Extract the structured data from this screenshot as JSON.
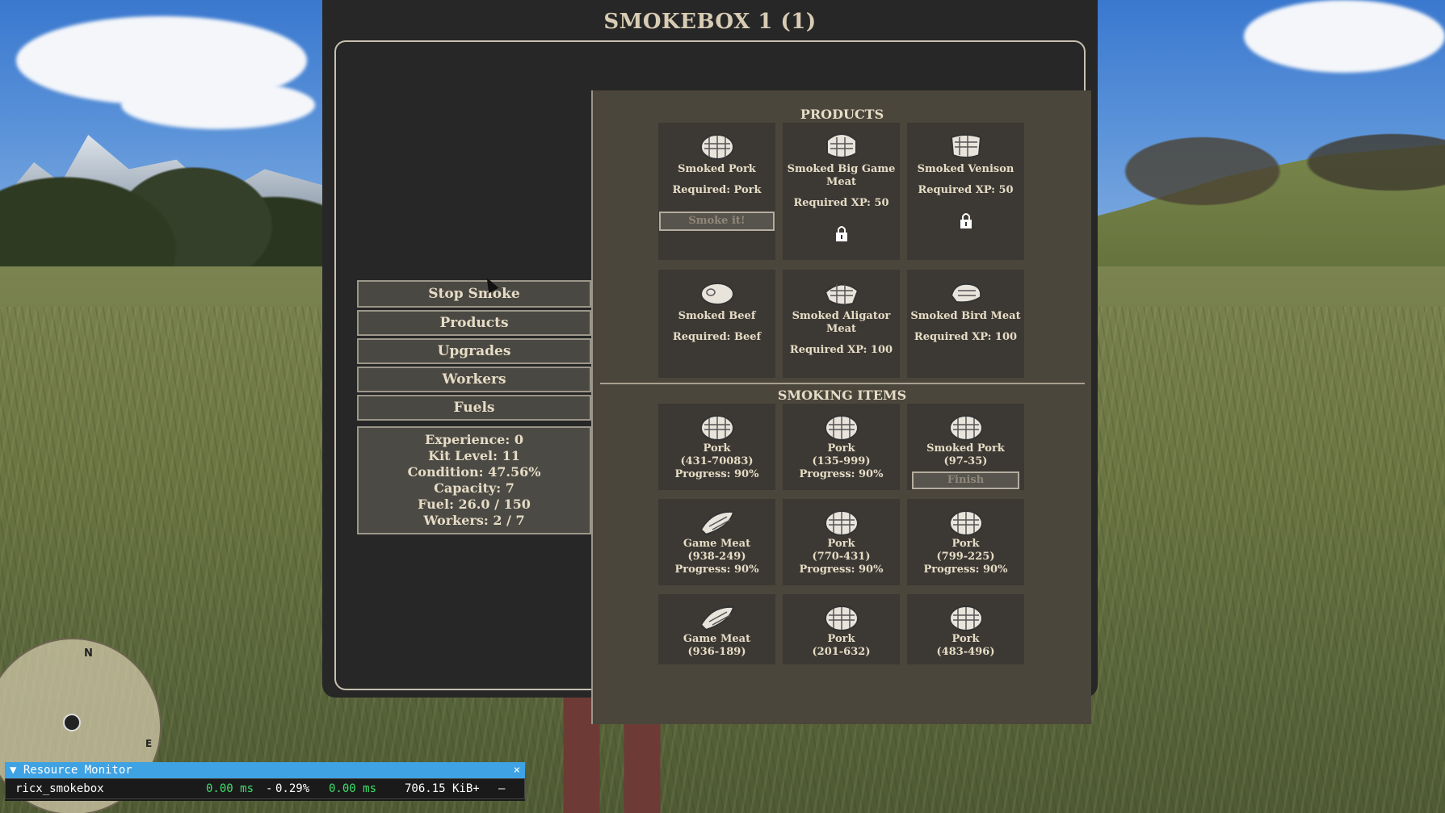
{
  "panel": {
    "title": "SMOKEBOX 1 (1)"
  },
  "sidebar": {
    "buttons": [
      "Stop Smoke",
      "Products",
      "Upgrades",
      "Workers",
      "Fuels"
    ],
    "stats": [
      "Experience: 0",
      "Kit Level: 11",
      "Condition: 47.56%",
      "Capacity: 7",
      "Fuel: 26.0 / 150",
      "Workers: 2 / 7"
    ]
  },
  "products": {
    "title": "PRODUCTS",
    "smoke_label": "Smoke it!",
    "items": [
      {
        "name": "Smoked Pork",
        "required": "Required: Pork",
        "locked": false,
        "icon": "pork-icon"
      },
      {
        "name": "Smoked Big Game Meat",
        "required": "Required XP: 50",
        "locked": true,
        "icon": "big-game-meat-icon"
      },
      {
        "name": "Smoked Venison",
        "required": "Required XP: 50",
        "locked": true,
        "icon": "venison-icon"
      },
      {
        "name": "Smoked Beef",
        "required": "Required: Beef",
        "locked": false,
        "icon": "beef-icon"
      },
      {
        "name": "Smoked Aligator Meat",
        "required": "Required XP: 100",
        "locked": false,
        "icon": "aligator-meat-icon"
      },
      {
        "name": "Smoked Bird Meat",
        "required": "Required XP: 100",
        "locked": false,
        "icon": "bird-meat-icon"
      }
    ]
  },
  "smoking_items": {
    "title": "SMOKING ITEMS",
    "finish_label": "Finish",
    "items": [
      {
        "name": "Pork",
        "code": "(431-70083)",
        "progress": "Progress: 90%",
        "icon": "pork-icon"
      },
      {
        "name": "Pork",
        "code": "(135-999)",
        "progress": "Progress: 90%",
        "icon": "pork-icon"
      },
      {
        "name": "Smoked Pork",
        "code": "(97-35)",
        "progress": "",
        "finish": true,
        "icon": "pork-icon"
      },
      {
        "name": "Game Meat",
        "code": "(938-249)",
        "progress": "Progress: 90%",
        "icon": "game-meat-icon"
      },
      {
        "name": "Pork",
        "code": "(770-431)",
        "progress": "Progress: 90%",
        "icon": "pork-icon"
      },
      {
        "name": "Pork",
        "code": "(799-225)",
        "progress": "Progress: 90%",
        "icon": "pork-icon"
      },
      {
        "name": "Game Meat",
        "code": "(936-189)",
        "progress": "",
        "icon": "game-meat-icon"
      },
      {
        "name": "Pork",
        "code": "(201-632)",
        "progress": "",
        "icon": "pork-icon"
      },
      {
        "name": "Pork",
        "code": "(483-496)",
        "progress": "",
        "icon": "pork-icon"
      }
    ]
  },
  "minimap": {
    "north": "N",
    "east": "E"
  },
  "resource_monitor": {
    "title": "Resource Monitor",
    "close": "×",
    "resource": "ricx_smokebox",
    "cpu_ms": "0.00 ms",
    "sep": "-",
    "cpu_pct": "0.29%",
    "time_ms": "0.00 ms",
    "memory": "706.15 KiB+",
    "minus": "–"
  },
  "colors": {
    "panel_bg": "#272727",
    "content_bg": "#4a463c",
    "card_bg": "#3c3934",
    "text": "#e6dcc6",
    "monitor_header": "#3ea2e3"
  }
}
